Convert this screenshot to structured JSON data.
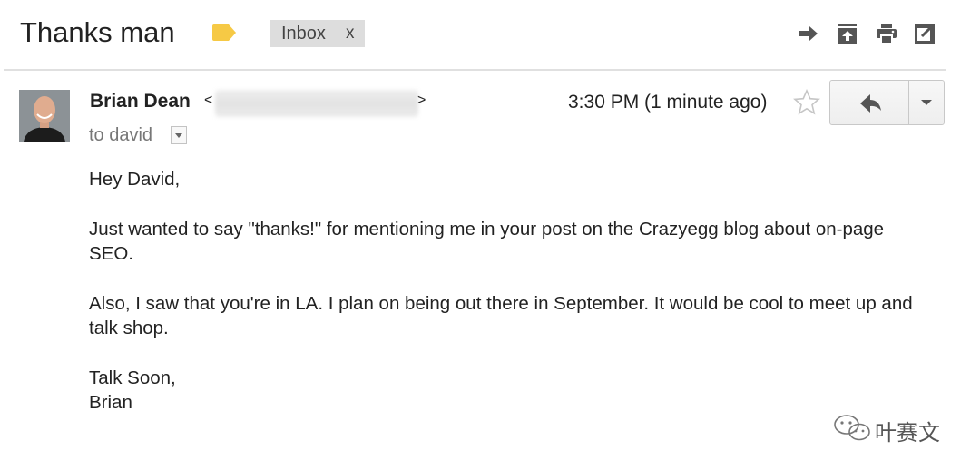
{
  "message": {
    "subject": "Thanks man",
    "label": {
      "name": "Inbox",
      "remove": "x"
    },
    "toolbar": [
      "forward-arrow-icon",
      "archive-up-icon",
      "print-icon",
      "open-in-new-window-icon"
    ],
    "label_tag_color": "#f6c945",
    "sender": {
      "name": "Brian Dean",
      "open_angle": "<",
      "close_angle": ">"
    },
    "recipient_line": "to david",
    "timestamp": "3:30 PM (1 minute ago)",
    "body": {
      "greeting": "Hey David,",
      "para1": "Just wanted to say \"thanks!\" for mentioning me in your post on the Crazyegg blog about on-page SEO.",
      "para2": "Also, I saw that you're in LA. I plan on being out there in September. It would be cool to meet up and talk shop.",
      "closing": "Talk Soon,",
      "signature": "Brian"
    }
  },
  "watermark": {
    "text": "叶赛文"
  }
}
